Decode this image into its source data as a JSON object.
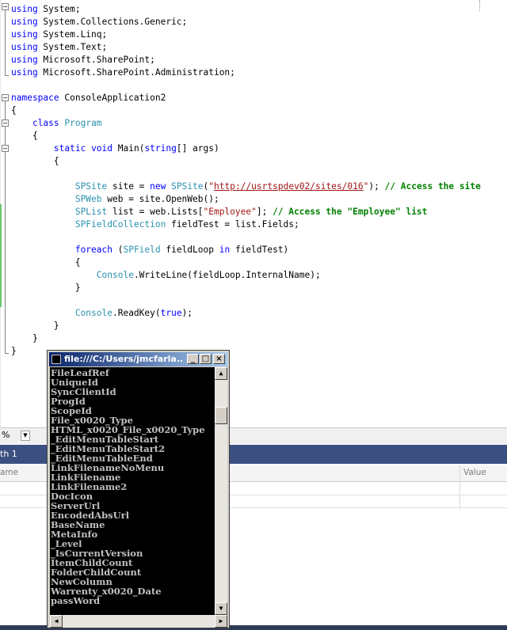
{
  "editor": {
    "lines": [
      [
        {
          "t": "using",
          "c": "kw"
        },
        {
          "t": " System;"
        }
      ],
      [
        {
          "t": "using",
          "c": "kw"
        },
        {
          "t": " System.Collections.Generic;"
        }
      ],
      [
        {
          "t": "using",
          "c": "kw"
        },
        {
          "t": " System.Linq;"
        }
      ],
      [
        {
          "t": "using",
          "c": "kw"
        },
        {
          "t": " System.Text;"
        }
      ],
      [
        {
          "t": "using",
          "c": "kw"
        },
        {
          "t": " Microsoft.SharePoint;"
        }
      ],
      [
        {
          "t": "using",
          "c": "kw"
        },
        {
          "t": " Microsoft.SharePoint.Administration;"
        }
      ],
      [],
      [
        {
          "t": "namespace",
          "c": "kw"
        },
        {
          "t": " ConsoleApplication2"
        }
      ],
      [
        {
          "t": "{"
        }
      ],
      [
        {
          "t": "    "
        },
        {
          "t": "class",
          "c": "kw"
        },
        {
          "t": " "
        },
        {
          "t": "Program",
          "c": "ty"
        }
      ],
      [
        {
          "t": "    {"
        }
      ],
      [
        {
          "t": "        "
        },
        {
          "t": "static",
          "c": "kw"
        },
        {
          "t": " "
        },
        {
          "t": "void",
          "c": "kw"
        },
        {
          "t": " Main("
        },
        {
          "t": "string",
          "c": "kw"
        },
        {
          "t": "[] args)"
        }
      ],
      [
        {
          "t": "        {"
        }
      ],
      [],
      [
        {
          "t": "            "
        },
        {
          "t": "SPSite",
          "c": "ty"
        },
        {
          "t": " site = "
        },
        {
          "t": "new",
          "c": "kw"
        },
        {
          "t": " "
        },
        {
          "t": "SPSite",
          "c": "ty"
        },
        {
          "t": "("
        },
        {
          "t": "\"",
          "c": "str"
        },
        {
          "t": "http://usrtspdev02/sites/016",
          "c": "lnk"
        },
        {
          "t": "\"",
          "c": "str"
        },
        {
          "t": "); "
        },
        {
          "t": "// Access the site",
          "c": "cm"
        }
      ],
      [
        {
          "t": "            "
        },
        {
          "t": "SPWeb",
          "c": "ty"
        },
        {
          "t": " web = site.OpenWeb();"
        }
      ],
      [
        {
          "t": "            "
        },
        {
          "t": "SPList",
          "c": "ty"
        },
        {
          "t": " list = web.Lists["
        },
        {
          "t": "\"Employee\"",
          "c": "str"
        },
        {
          "t": "]; "
        },
        {
          "t": "// Access the \"Employee\" list",
          "c": "cm"
        }
      ],
      [
        {
          "t": "            "
        },
        {
          "t": "SPFieldCollection",
          "c": "ty"
        },
        {
          "t": " fieldTest = list.Fields;"
        }
      ],
      [],
      [
        {
          "t": "            "
        },
        {
          "t": "foreach",
          "c": "kw"
        },
        {
          "t": " ("
        },
        {
          "t": "SPField",
          "c": "ty"
        },
        {
          "t": " fieldLoop "
        },
        {
          "t": "in",
          "c": "kw"
        },
        {
          "t": " fieldTest)"
        }
      ],
      [
        {
          "t": "            {"
        }
      ],
      [
        {
          "t": "                "
        },
        {
          "t": "Console",
          "c": "ty"
        },
        {
          "t": ".WriteLine(fieldLoop.InternalName);"
        }
      ],
      [
        {
          "t": "            }"
        }
      ],
      [],
      [
        {
          "t": "            "
        },
        {
          "t": "Console",
          "c": "ty"
        },
        {
          "t": ".ReadKey("
        },
        {
          "t": "true",
          "c": "kw"
        },
        {
          "t": ");"
        }
      ],
      [
        {
          "t": "        }"
        }
      ],
      [
        {
          "t": "    }"
        }
      ],
      [
        {
          "t": "}"
        }
      ]
    ]
  },
  "zoom": {
    "value": "%"
  },
  "locals": {
    "title": "th 1",
    "col_name": "ame",
    "col_value": "Value"
  },
  "console": {
    "title": "file:///C:/Users/jmcfarla...",
    "buttons": {
      "minimize": "_",
      "maximize": "□",
      "close": "×"
    },
    "lines": [
      "FileLeafRef",
      "UniqueId",
      "SyncClientId",
      "ProgId",
      "ScopeId",
      "File_x0020_Type",
      "HTML_x0020_File_x0020_Type",
      "_EditMenuTableStart",
      "_EditMenuTableStart2",
      "_EditMenuTableEnd",
      "LinkFilenameNoMenu",
      "LinkFilename",
      "LinkFilename2",
      "DocIcon",
      "ServerUrl",
      "EncodedAbsUrl",
      "BaseName",
      "MetaInfo",
      "_Level",
      "_IsCurrentVersion",
      "ItemChildCount",
      "FolderChildCount",
      "NewColumn",
      "Warrenty_x0020_Date",
      "passWord"
    ]
  }
}
